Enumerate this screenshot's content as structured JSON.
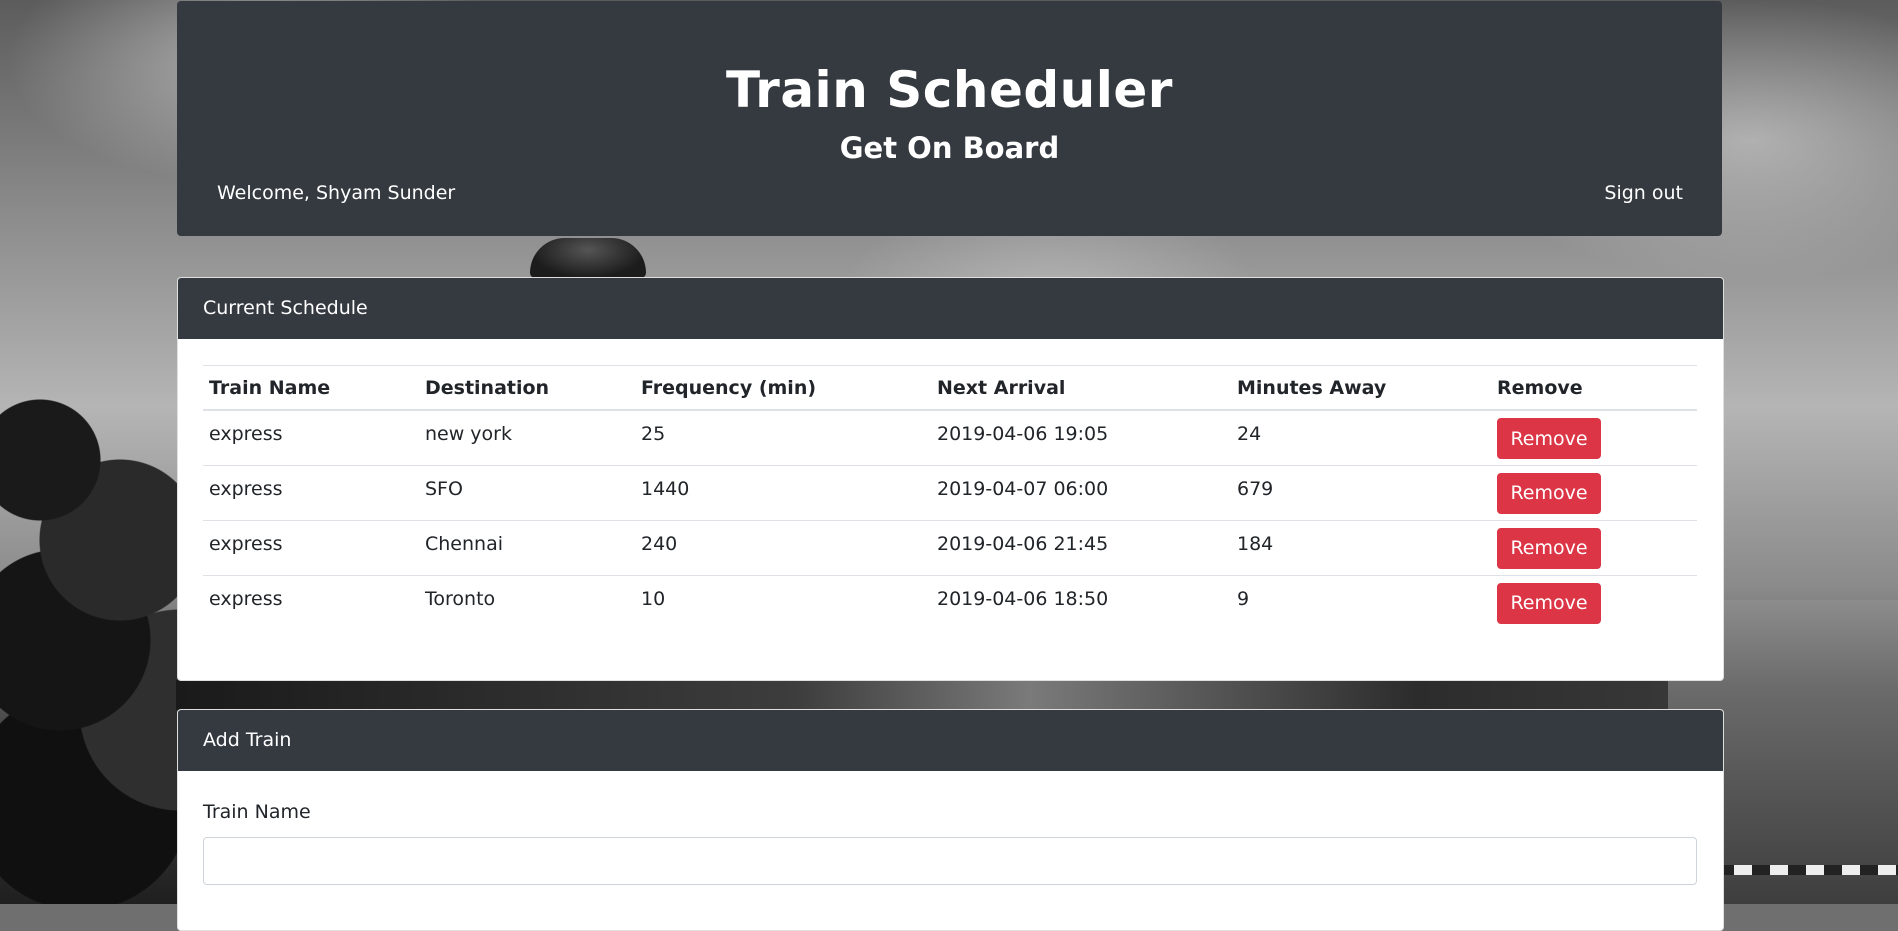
{
  "header": {
    "title": "Train Scheduler",
    "subtitle": "Get On Board",
    "welcome": "Welcome, Shyam Sunder",
    "sign_out": "Sign out"
  },
  "schedule": {
    "title": "Current Schedule",
    "columns": [
      "Train Name",
      "Destination",
      "Frequency (min)",
      "Next Arrival",
      "Minutes Away",
      "Remove"
    ],
    "rows": [
      {
        "train_name": "express",
        "destination": "new york",
        "frequency": "25",
        "next_arrival": "2019-04-06 19:05",
        "minutes_away": "24",
        "remove_label": "Remove"
      },
      {
        "train_name": "express",
        "destination": "SFO",
        "frequency": "1440",
        "next_arrival": "2019-04-07 06:00",
        "minutes_away": "679",
        "remove_label": "Remove"
      },
      {
        "train_name": "express",
        "destination": "Chennai",
        "frequency": "240",
        "next_arrival": "2019-04-06 21:45",
        "minutes_away": "184",
        "remove_label": "Remove"
      },
      {
        "train_name": "express",
        "destination": "Toronto",
        "frequency": "10",
        "next_arrival": "2019-04-06 18:50",
        "minutes_away": "9",
        "remove_label": "Remove"
      }
    ]
  },
  "add_train": {
    "title": "Add Train",
    "train_name_label": "Train Name",
    "train_name_value": ""
  },
  "colors": {
    "panel_dark": "#343a40",
    "danger": "#dc3545"
  }
}
